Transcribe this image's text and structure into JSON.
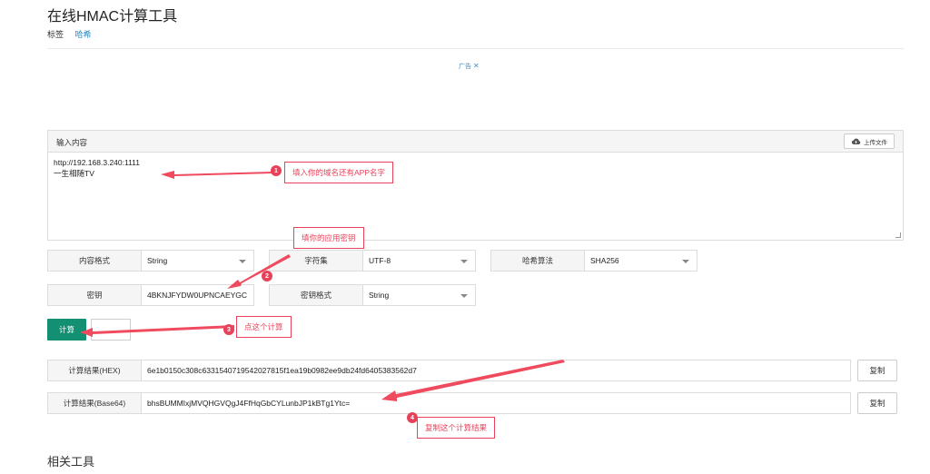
{
  "page": {
    "title": "在线HMAC计算工具",
    "tag_label": "标签",
    "tag_link": "哈希"
  },
  "ad": {
    "label": "广告",
    "close": "✕"
  },
  "input_panel": {
    "title": "输入内容",
    "upload_label": "上传文件",
    "upload_icon": "cloud-upload-icon",
    "content": "http://192.168.3.240:1111\n一生相随TV"
  },
  "options": {
    "content_format_label": "内容格式",
    "content_format_value": "String",
    "charset_label": "字符集",
    "charset_value": "UTF-8",
    "hash_algo_label": "哈希算法",
    "hash_algo_value": "SHA256",
    "key_label": "密钥",
    "key_value": "4BKNJFYDW0UPNCAEYGC",
    "key_format_label": "密钥格式",
    "key_format_value": "String"
  },
  "actions": {
    "calc_label": "计算"
  },
  "results": {
    "hex_label": "计算结果(HEX)",
    "hex_value": "6e1b0150c308c6331540719542027815f1ea19b0982ee9db24fd6405383562d7",
    "b64_label": "计算结果(Base64)",
    "b64_value": "bhsBUMMIxjMVQHGVQgJ4FfHqGbCYLunbJP1kBTg1Ytc=",
    "copy_label": "复制"
  },
  "related": {
    "title": "相关工具"
  },
  "annotations": [
    {
      "number": "1",
      "text": "填入你的域名还有APP名字"
    },
    {
      "number": "2",
      "text": "填你的应用密钥"
    },
    {
      "number": "3",
      "text": "点这个计算"
    },
    {
      "number": "4",
      "text": "复制这个计算结果"
    }
  ],
  "colors": {
    "accent": "#138f72",
    "annotation": "#e8425a",
    "link": "#1e88c9"
  }
}
